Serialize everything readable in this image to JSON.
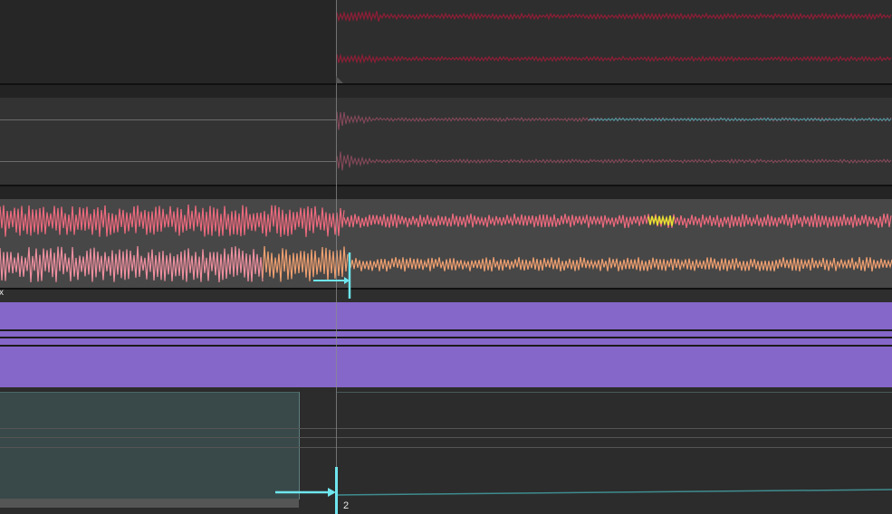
{
  "editor": {
    "playhead_marker_label": "2",
    "clip_corner_label": "x"
  },
  "colors": {
    "background": "#2b2b2b",
    "track1_wave": "#8e1e36",
    "track2_wave": "#8a4a5d",
    "track2_wave_accent": "#4aa0a8",
    "track3_wave_top": "#ef6a7e",
    "track3_wave_bottom": "#f0a070",
    "track3_highlight": "#e8e030",
    "purple_clip": "#8567c9",
    "automation_clip": "#39494a",
    "marker": "#6ee6ee"
  }
}
